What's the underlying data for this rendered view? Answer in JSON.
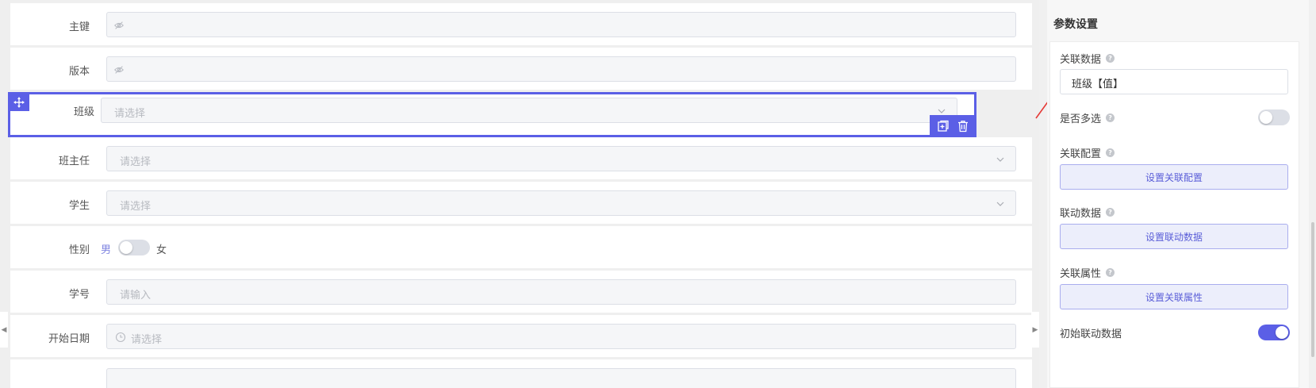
{
  "form": {
    "fields": [
      {
        "label": "主键",
        "placeholder": ""
      },
      {
        "label": "版本",
        "placeholder": ""
      },
      {
        "label": "班级",
        "placeholder": "请选择"
      },
      {
        "label": "班主任",
        "placeholder": "请选择"
      },
      {
        "label": "学生",
        "placeholder": "请选择"
      },
      {
        "label": "性别",
        "switch_off_label": "男",
        "switch_on_label": "女"
      },
      {
        "label": "学号",
        "placeholder": "请输入"
      },
      {
        "label": "开始日期",
        "placeholder": "请选择"
      }
    ]
  },
  "panel": {
    "title": "参数设置",
    "related_data_label": "关联数据",
    "related_data_value": "班级【值】",
    "multi_select_label": "是否多选",
    "multi_select_on": false,
    "related_config_label": "关联配置",
    "related_config_button": "设置关联配置",
    "linkage_data_label": "联动数据",
    "linkage_data_button": "设置联动数据",
    "related_attr_label": "关联属性",
    "related_attr_button": "设置关联属性",
    "initial_linkage_label": "初始联动数据",
    "initial_linkage_on": true
  },
  "colors": {
    "accent": "#5b5fe6",
    "selected_outline": "#5b5fe6",
    "arrow": "#e53935"
  }
}
